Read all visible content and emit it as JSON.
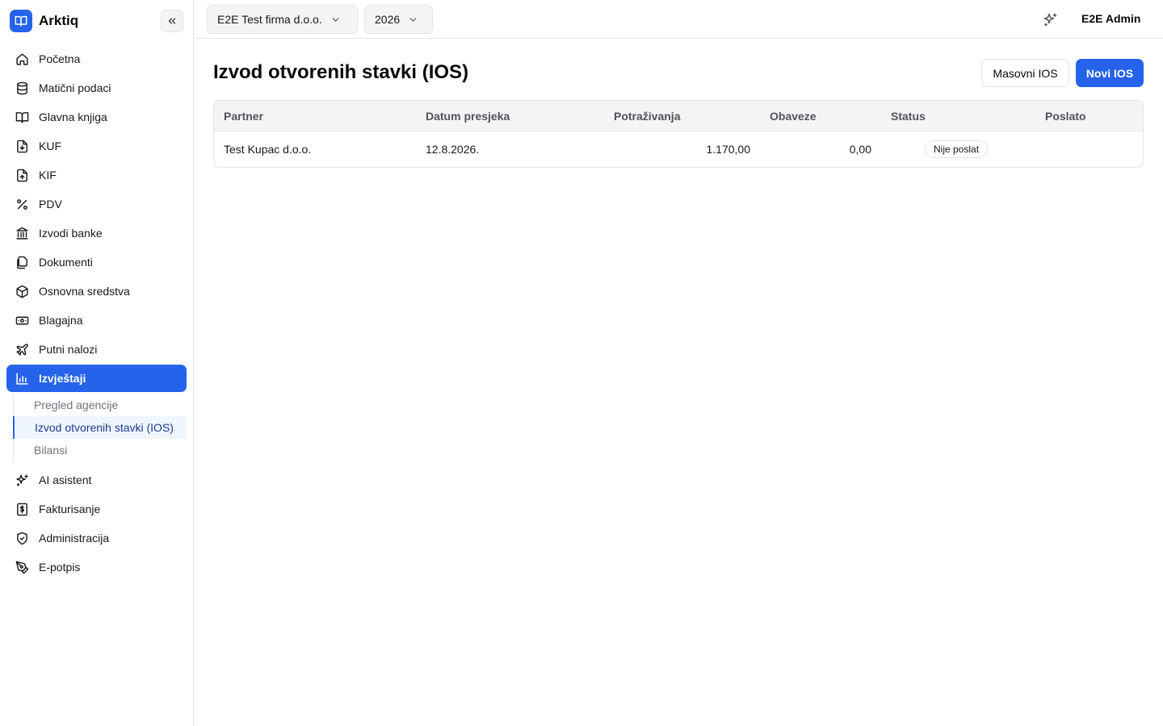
{
  "app": {
    "name": "Arktiq"
  },
  "sidebar": {
    "items": [
      {
        "label": "Početna",
        "icon": "home-icon"
      },
      {
        "label": "Matični podaci",
        "icon": "database-icon"
      },
      {
        "label": "Glavna knjiga",
        "icon": "book-open-icon"
      },
      {
        "label": "KUF",
        "icon": "file-download-icon"
      },
      {
        "label": "KIF",
        "icon": "file-upload-icon"
      },
      {
        "label": "PDV",
        "icon": "percent-icon"
      },
      {
        "label": "Izvodi banke",
        "icon": "bank-icon"
      },
      {
        "label": "Dokumenti",
        "icon": "files-icon"
      },
      {
        "label": "Osnovna sredstva",
        "icon": "package-icon"
      },
      {
        "label": "Blagajna",
        "icon": "banknote-icon"
      },
      {
        "label": "Putni nalozi",
        "icon": "plane-icon"
      },
      {
        "label": "Izvještaji",
        "icon": "bar-chart-icon"
      }
    ],
    "subitems": [
      {
        "label": "Pregled agencije"
      },
      {
        "label": "Izvod otvorenih stavki (IOS)"
      },
      {
        "label": "Bilansi"
      }
    ],
    "items_after": [
      {
        "label": "AI asistent",
        "icon": "sparkles-icon"
      },
      {
        "label": "Fakturisanje",
        "icon": "invoice-dollar-icon"
      },
      {
        "label": "Administracija",
        "icon": "shield-check-icon"
      },
      {
        "label": "E-potpis",
        "icon": "signature-pen-icon"
      }
    ]
  },
  "topbar": {
    "company": "E2E Test firma d.o.o.",
    "year": "2026",
    "user": "E2E Admin"
  },
  "page": {
    "title": "Izvod otvorenih stavki (IOS)",
    "mass_button": "Masovni IOS",
    "new_button": "Novi IOS"
  },
  "table": {
    "headers": [
      "Partner",
      "Datum presjeka",
      "Potraživanja",
      "Obaveze",
      "Status",
      "Poslato"
    ],
    "rows": [
      {
        "partner": "Test Kupac d.o.o.",
        "date": "12.8.2026.",
        "receivables": "1.170,00",
        "liabilities": "0,00",
        "status": "Nije poslat",
        "sent": ""
      }
    ]
  },
  "colors": {
    "accent": "#2563eb",
    "active_sub_bg": "#eff6ff",
    "border": "#e4e4e7"
  }
}
